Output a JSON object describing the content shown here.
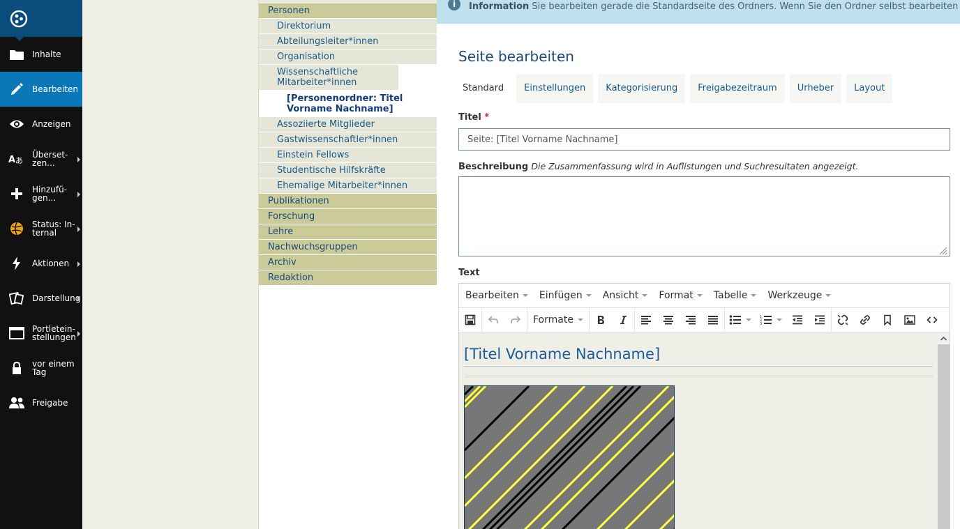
{
  "toolbar": {
    "items": [
      {
        "label": "Inhalte",
        "icon": "folder-icon",
        "active": false,
        "submenu": false
      },
      {
        "label": "Bearbeiten",
        "icon": "pencil-icon",
        "active": true,
        "submenu": false
      },
      {
        "label": "Anzeigen",
        "icon": "eye-icon",
        "active": false,
        "submenu": false
      },
      {
        "label": "Überset-\nzen...",
        "icon": "translate-icon",
        "active": false,
        "submenu": true
      },
      {
        "label": "Hinzufü-\ngen...",
        "icon": "plus-icon",
        "active": false,
        "submenu": true
      },
      {
        "label": "Status: In-\nternal",
        "icon": "status-icon",
        "active": false,
        "submenu": true
      },
      {
        "label": "Aktionen",
        "icon": "bolt-icon",
        "active": false,
        "submenu": true
      },
      {
        "label": "Darstellung",
        "icon": "display-icon",
        "active": false,
        "submenu": true
      },
      {
        "label": "Portletein-\nstellungen",
        "icon": "portlet-icon",
        "active": false,
        "submenu": true
      },
      {
        "label": "vor einem\nTag",
        "icon": "lock-icon",
        "active": false,
        "submenu": false
      },
      {
        "label": "Freigabe",
        "icon": "users-icon",
        "active": false,
        "submenu": false
      }
    ]
  },
  "nav": {
    "personen": "Personen",
    "children": [
      "Direktorium",
      "Abteilungsleiter*innen",
      "Organisation",
      "Wissenschaftliche Mitarbeiter*innen"
    ],
    "current": "[Personenordner: Titel Vorname Nachname]",
    "children_after": [
      "Assoziierte Mitglieder",
      "Gastwissenschaftler*innen",
      "Einstein Fellows",
      "Studentische Hilfskräfte",
      "Ehemalige Mitarbeiter*innen"
    ],
    "top_after": [
      "Publikationen",
      "Forschung",
      "Lehre",
      "Nachwuchsgruppen",
      "Archiv",
      "Redaktion"
    ]
  },
  "info": {
    "label": "Information",
    "text": "Sie bearbeiten gerade die Standardseite des Ordners. Wenn Sie den Ordner selbst bearbeiten"
  },
  "form": {
    "heading": "Seite bearbeiten",
    "tabs": [
      "Standard",
      "Einstellungen",
      "Kategorisierung",
      "Freigabezeitraum",
      "Urheber",
      "Layout"
    ],
    "title_label": "Titel",
    "required_mark": "*",
    "title_value": "Seite: [Titel Vorname Nachname]",
    "desc_label": "Beschreibung",
    "desc_hint": "Die Zusammenfassung wird in Auflistungen und Suchresultaten angezeigt.",
    "text_label": "Text"
  },
  "editor": {
    "menus": [
      "Bearbeiten",
      "Einfügen",
      "Ansicht",
      "Format",
      "Tabelle",
      "Werkzeuge"
    ],
    "formats_label": "Formate",
    "content_heading": "[Titel Vorname Nachname]"
  }
}
